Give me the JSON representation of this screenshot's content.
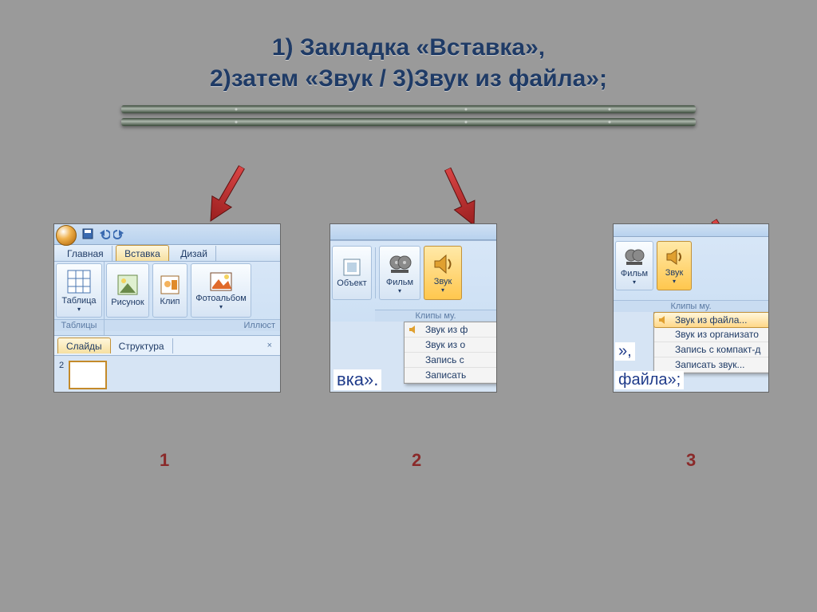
{
  "title_line1": "1) Закладка «Вставка»,",
  "title_line2": "2)затем  «Звук / 3)Звук из файла»;",
  "steps": {
    "s1": "1",
    "s2": "2",
    "s3": "3"
  },
  "shot1": {
    "tabs": {
      "home": "Главная",
      "insert": "Вставка",
      "design": "Дизай"
    },
    "btn_table": "Таблица",
    "btn_picture": "Рисунок",
    "btn_clip": "Клип",
    "btn_album": "Фотоальбом",
    "group_tables": "Таблицы",
    "group_illust": "Иллюст",
    "pane_slides": "Слайды",
    "pane_outline": "Структура",
    "slide_num": "2"
  },
  "shot2": {
    "btn_object": "Объект",
    "btn_movie": "Фильм",
    "btn_sound": "Звук",
    "group_clips": "Клипы му.",
    "menu": {
      "from_file": "Звук из ф",
      "from_org": "Звук из о",
      "record_cd": "Запись с",
      "record_sound": "Записать"
    },
    "snip": "вка»."
  },
  "shot3": {
    "btn_movie": "Фильм",
    "btn_sound": "Звук",
    "group_clips": "Клипы му.",
    "menu": {
      "from_file": "Звук из файла...",
      "from_org": "Звук из организато",
      "record_cd": "Запись с компакт-д",
      "record_sound": "Записать звук..."
    },
    "snip1": "»,",
    "snip2": "файла»;"
  }
}
